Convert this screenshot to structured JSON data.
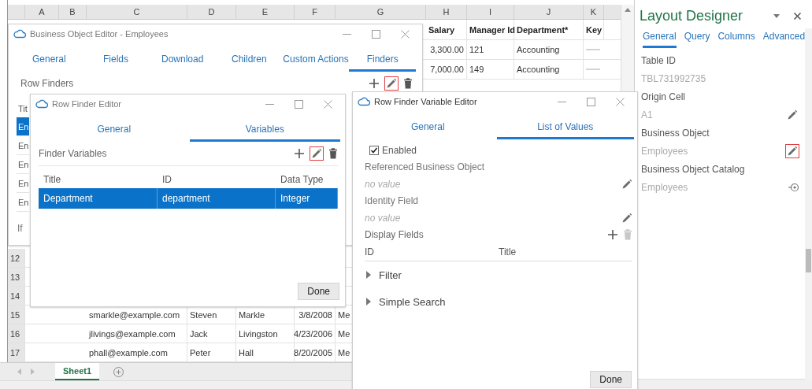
{
  "sheet": {
    "columns": [
      "A",
      "B",
      "C",
      "D",
      "E",
      "F",
      "G",
      "H",
      "I",
      "J",
      "K"
    ],
    "table_header": [
      "Salary",
      "Manager Id",
      "Department*",
      "Key"
    ],
    "top_rows": [
      {
        "salary": "3,300.00",
        "manager_id": "121",
        "department": "Accounting"
      },
      {
        "salary": "7,000.00",
        "manager_id": "149",
        "department": "Accounting"
      }
    ],
    "bottom_rows": [
      {
        "number": "12"
      },
      {
        "number": "13"
      },
      {
        "number": "14"
      },
      {
        "number": "15",
        "email": "smarkle@example.com",
        "first_name": "Steven",
        "last_name": "Markle",
        "date": "3/8/2008",
        "column_g": "Me"
      },
      {
        "number": "16",
        "email": "jlivings@example.com",
        "first_name": "Jack",
        "last_name": "Livingston",
        "date": "4/23/2006",
        "column_g": "Me"
      },
      {
        "number": "17",
        "email": "phall@example.com",
        "first_name": "Peter",
        "last_name": "Hall",
        "date": "8/20/2005",
        "column_g": "Me"
      }
    ],
    "sheet_tabs": [
      {
        "label": "Sheet1",
        "selected": true
      }
    ]
  },
  "bo_editor": {
    "title": "Business Object Editor - Employees",
    "tabs": [
      {
        "label": "General",
        "selected": false
      },
      {
        "label": "Fields",
        "selected": false
      },
      {
        "label": "Download",
        "selected": false
      },
      {
        "label": "Children",
        "selected": false
      },
      {
        "label": "Custom Actions",
        "selected": false
      },
      {
        "label": "Finders",
        "selected": true
      }
    ],
    "section": "Row Finders",
    "edit_highlighted": true,
    "table_header": "Tit",
    "rows": [
      {
        "text": "En",
        "selected": true
      },
      {
        "text": "En",
        "selected": false
      },
      {
        "text": "En",
        "selected": false
      },
      {
        "text": "En",
        "selected": false
      },
      {
        "text": "En",
        "selected": false
      }
    ],
    "footer_text": "If"
  },
  "row_finder_editor": {
    "title": "Row Finder Editor",
    "tabs": [
      {
        "label": "General",
        "selected": false
      },
      {
        "label": "Variables",
        "selected": true
      }
    ],
    "section": "Finder Variables",
    "edit_highlighted": true,
    "columns": [
      "Title",
      "ID",
      "Data Type"
    ],
    "rows": [
      {
        "cells": [
          "Department",
          "department",
          "Integer"
        ],
        "selected": true
      }
    ],
    "done": "Done"
  },
  "variable_editor": {
    "title": "Row Finder Variable Editor",
    "tabs": [
      {
        "label": "General",
        "selected": false
      },
      {
        "label": "List of Values",
        "selected": true
      }
    ],
    "enabled": {
      "label": "Enabled",
      "checked": true
    },
    "fields": [
      {
        "label": "Referenced Business Object",
        "value": "no value"
      },
      {
        "label": "Identity Field",
        "value": "no value"
      }
    ],
    "display_fields": {
      "label": "Display Fields",
      "columns": [
        "ID",
        "Title"
      ],
      "delete_disabled": true
    },
    "sections": [
      {
        "label": "Filter",
        "expanded": false
      },
      {
        "label": "Simple Search",
        "expanded": false
      }
    ],
    "done": "Done"
  },
  "layout_designer": {
    "title": "Layout Designer",
    "tabs": [
      {
        "label": "General",
        "selected": true
      },
      {
        "label": "Query",
        "selected": false
      },
      {
        "label": "Columns",
        "selected": false
      },
      {
        "label": "Advanced",
        "selected": false
      }
    ],
    "properties": [
      {
        "label": "Table ID",
        "value": "TBL731992735",
        "kind": "plain"
      },
      {
        "label": "Origin Cell",
        "value": "A1",
        "kind": "edit",
        "highlighted": false
      },
      {
        "label": "Business Object",
        "value": "Employees",
        "kind": "edit",
        "highlighted": true
      },
      {
        "label": "Business Object Catalog",
        "value": "Employees",
        "kind": "view"
      }
    ]
  }
}
